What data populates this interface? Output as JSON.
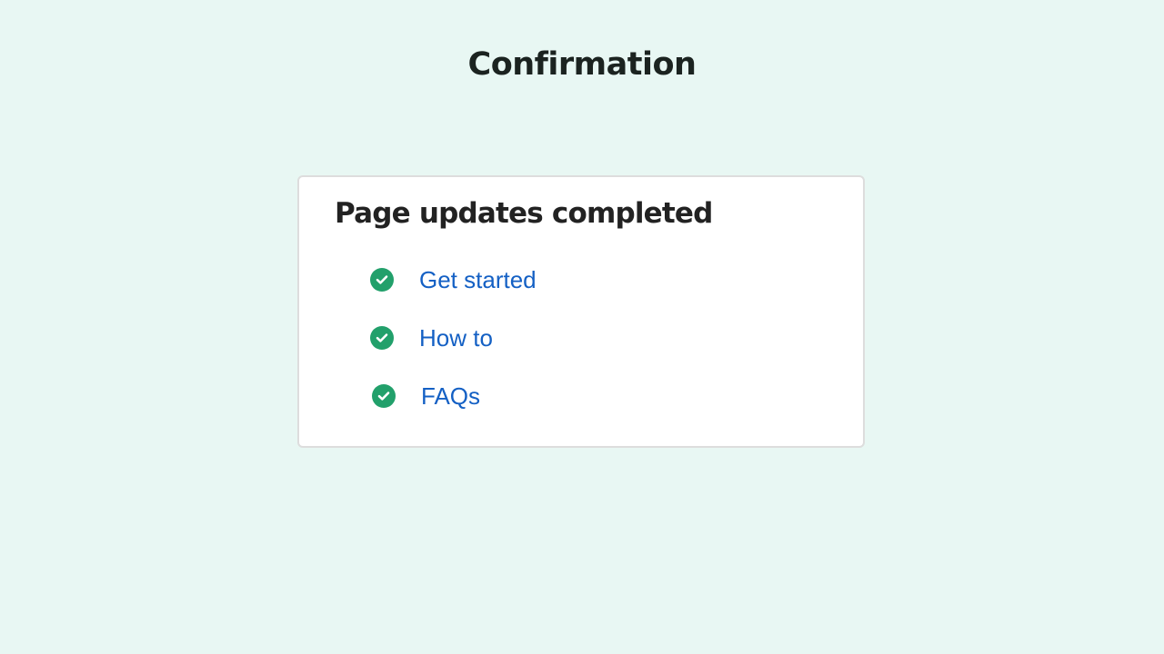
{
  "page": {
    "title": "Confirmation"
  },
  "card": {
    "title": "Page updates completed",
    "items": [
      {
        "label": "Get started",
        "icon": "check-circle-icon"
      },
      {
        "label": "How to",
        "icon": "check-circle-icon"
      },
      {
        "label": "FAQs",
        "icon": "check-circle-icon"
      }
    ]
  },
  "colors": {
    "background": "#e8f7f3",
    "success": "#22a06b",
    "link": "#1460c4",
    "heading": "#1b2320"
  }
}
